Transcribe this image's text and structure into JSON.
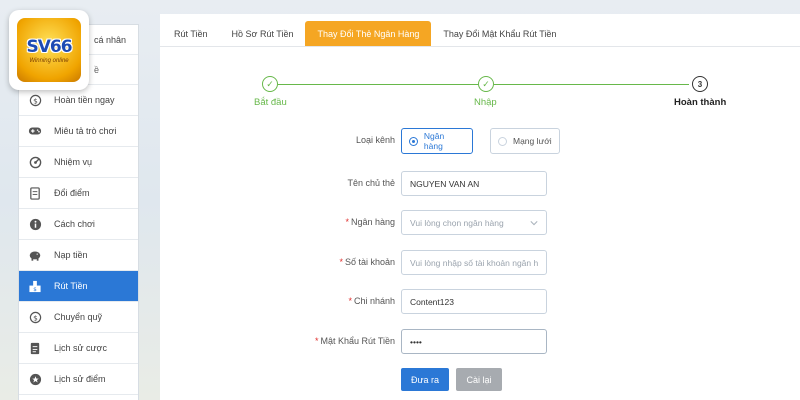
{
  "logo": {
    "text": "SV66",
    "sub": "Winning online"
  },
  "sidebar": {
    "items": [
      {
        "label": "cá nhân",
        "icon": "user-icon"
      },
      {
        "label": "...",
        "icon": "wallet-icon"
      },
      {
        "label": "Hoàn tiền ngay",
        "icon": "refund-icon"
      },
      {
        "label": "Miêu tả trò chơi",
        "icon": "gamepad-icon"
      },
      {
        "label": "Nhiệm vụ",
        "icon": "mission-icon"
      },
      {
        "label": "Đổi điểm",
        "icon": "exchange-icon"
      },
      {
        "label": "Cách chơi",
        "icon": "info-icon"
      },
      {
        "label": "Nạp tiền",
        "icon": "piggy-bank-icon"
      },
      {
        "label": "Rút Tiền",
        "icon": "withdraw-icon"
      },
      {
        "label": "Chuyển quỹ",
        "icon": "transfer-icon"
      },
      {
        "label": "Lịch sử cược",
        "icon": "history-icon"
      },
      {
        "label": "Lịch sử điểm",
        "icon": "points-icon"
      }
    ],
    "active_index": 8
  },
  "tabs": [
    {
      "label": "Rút Tiền"
    },
    {
      "label": "Hồ Sơ Rút Tiền"
    },
    {
      "label": "Thay Đổi Thẻ Ngân Hàng"
    },
    {
      "label": "Thay Đổi Mật Khẩu Rút Tiền"
    }
  ],
  "active_tab": 2,
  "stepper": {
    "steps": [
      {
        "label": "Bắt đầu",
        "state": "done"
      },
      {
        "label": "Nhập",
        "state": "done"
      },
      {
        "label": "Hoàn thành",
        "state": "current",
        "number": "3"
      }
    ],
    "check_glyph": "✓"
  },
  "form": {
    "channel_label": "Loại kênh",
    "channel_options": [
      "Ngân hàng",
      "Mạng lưới"
    ],
    "channel_selected": "Ngân hàng",
    "holder_label": "Tên chủ thẻ",
    "holder_value": "NGUYEN VAN AN",
    "bank_label": "Ngân hàng",
    "bank_placeholder": "Vui lòng chọn ngân hàng",
    "account_label": "Số tài khoản",
    "account_placeholder": "Vui lòng nhập số tài khoản ngân hà",
    "branch_label": "Chi nhánh",
    "branch_value": "Content123",
    "password_label": "Mật Khẩu Rút Tiền",
    "password_value": "••••",
    "required_mark": "*"
  },
  "buttons": {
    "submit": "Đưa ra",
    "reset": "Cài lại"
  },
  "colors": {
    "accent": "#2b78d6",
    "tab_active": "#f5a623",
    "success": "#67b84a",
    "required": "#e0302e"
  }
}
